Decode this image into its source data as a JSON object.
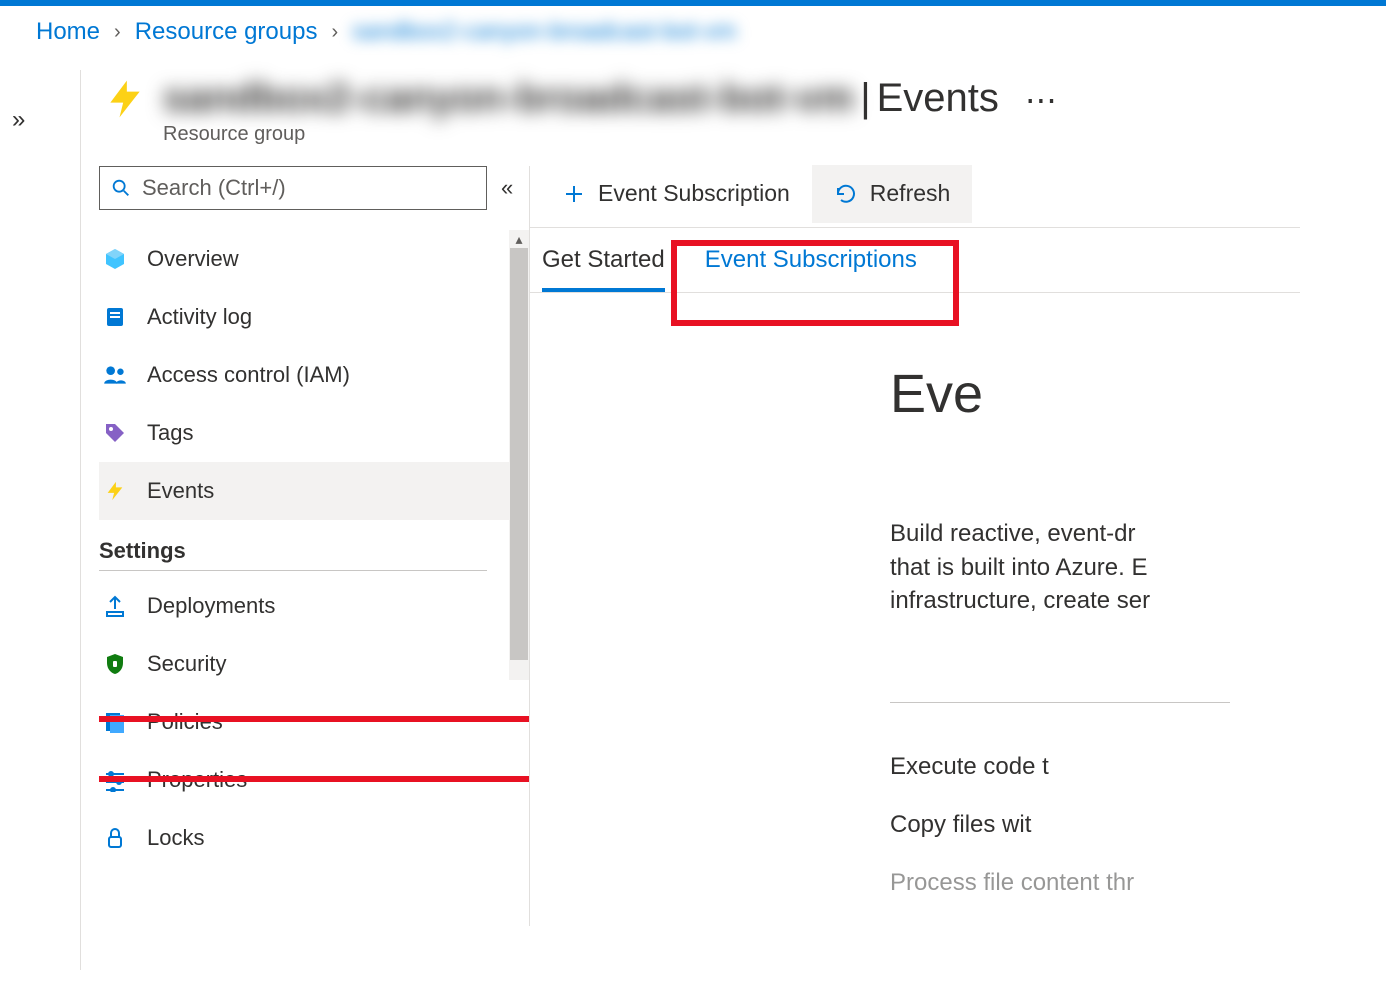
{
  "breadcrumb": {
    "home": "Home",
    "resource_groups": "Resource groups",
    "current_blur": "sandbox2-canyon-broadcast-bot-vm"
  },
  "header": {
    "resource_name_blur": "sandbox2-canyon-broadcast-bot-vm",
    "separator": "|",
    "page": "Events",
    "subtitle": "Resource group"
  },
  "sidebar": {
    "search_placeholder": "Search (Ctrl+/)",
    "items": [
      {
        "label": "Overview"
      },
      {
        "label": "Activity log"
      },
      {
        "label": "Access control (IAM)"
      },
      {
        "label": "Tags"
      },
      {
        "label": "Events"
      }
    ],
    "settings_header": "Settings",
    "settings_items": [
      {
        "label": "Deployments"
      },
      {
        "label": "Security"
      },
      {
        "label": "Policies"
      },
      {
        "label": "Properties"
      },
      {
        "label": "Locks"
      }
    ]
  },
  "toolbar": {
    "event_subscription": "Event Subscription",
    "refresh": "Refresh"
  },
  "tabs": {
    "get_started": "Get Started",
    "event_subscriptions": "Event Subscriptions"
  },
  "content": {
    "heading": "Eve",
    "body1": "Build reactive, event-dr",
    "body2": "that is built into Azure. E",
    "body3": "infrastructure, create ser",
    "line1": "Execute code t",
    "line2": "Copy files wit",
    "line3": "Process file content thr"
  },
  "colors": {
    "azure_blue": "#0078d4",
    "highlight_red": "#e81123"
  }
}
